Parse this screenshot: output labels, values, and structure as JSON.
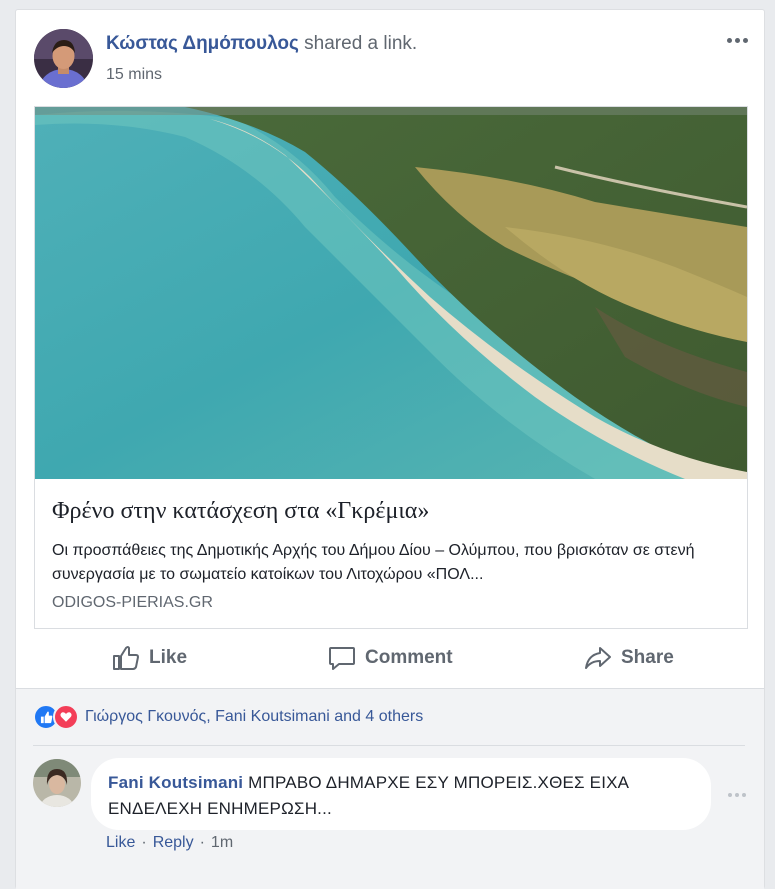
{
  "post": {
    "author": "Κώστας Δημόπουλος",
    "action_text": "shared a link.",
    "time": "15 mins",
    "link": {
      "title": "Φρένο στην κατάσχεση στα «Γκρέμια»",
      "description": "Οι προσπάθειες της Δημοτικής Αρχής του Δήμου Δίου – Ολύμπου, που βρισκόταν σε στενή συνεργασία με το σωματείο κατοίκων του Λιτοχώρου «ΠΟΛ...",
      "domain": "ODIGOS-PIERIAS.GR"
    }
  },
  "actions": {
    "like": "Like",
    "comment": "Comment",
    "share": "Share"
  },
  "reactions": {
    "icons": [
      "like-reaction-icon",
      "love-reaction-icon"
    ],
    "summary": "Γιώργος Γκουνός, Fani Koutsimani and 4 others"
  },
  "comment": {
    "author": "Fani Koutsimani",
    "text": "ΜΠΡΑΒΟ ΔΗΜΑΡΧΕ ΕΣΥ ΜΠΟΡΕΙΣ.ΧΘΕΣ ΕΙΧΑ ΕΝΔΕΛΕΧΗ ΕΝΗΜΕΡΩΣΗ...",
    "like_label": "Like",
    "reply_label": "Reply",
    "time": "1m"
  },
  "colors": {
    "link_blue": "#385898",
    "secondary_gray": "#606770",
    "like_blue": "#2078f4",
    "love_red": "#f33e58",
    "background": "#e9ebee"
  }
}
